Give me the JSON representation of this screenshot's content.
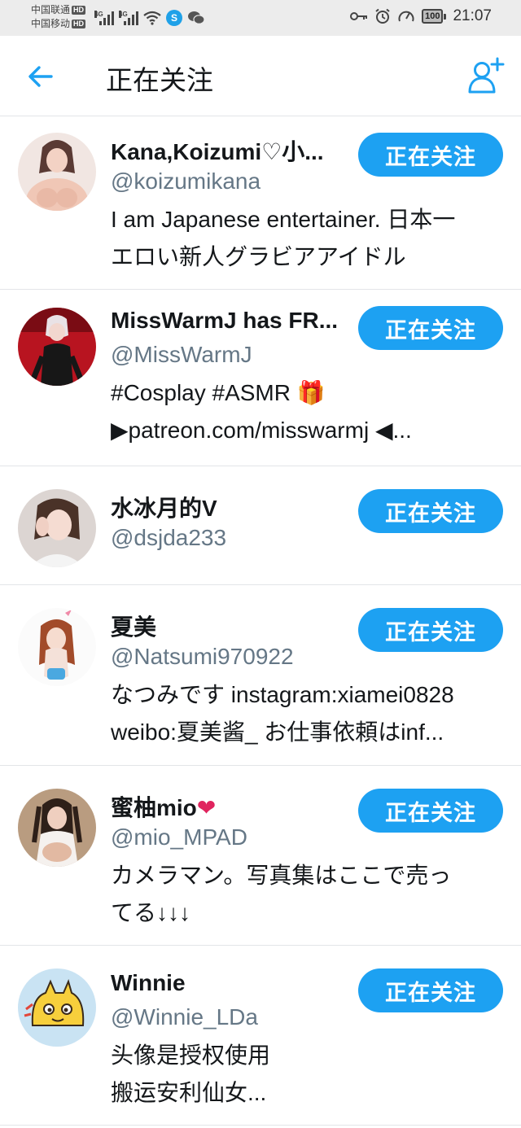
{
  "status_bar": {
    "carrier1": "中国联通",
    "carrier2": "中国移动",
    "hd": "HD",
    "net1": "4G",
    "net2": "4G",
    "battery": "100",
    "time": "21:07"
  },
  "header": {
    "title": "正在关注",
    "back_icon": "arrow-left-icon",
    "add_icon": "add-user-icon"
  },
  "users": [
    {
      "name": "Kana,Koizumi♡小...",
      "handle": "@koizumikana",
      "bio": [
        "I am Japanese entertainer.  日本一",
        "エロい新人グラビアアイドル"
      ],
      "button": "正在关注"
    },
    {
      "name": "MissWarmJ has FR...",
      "handle": "@MissWarmJ",
      "bio": [
        "#Cosplay #ASMR 🎁",
        "▶patreon.com/misswarmj ◀..."
      ],
      "button": "正在关注"
    },
    {
      "name": "水冰月的V",
      "handle": "@dsjda233",
      "bio": [],
      "button": "正在关注"
    },
    {
      "name": "夏美",
      "handle": "@Natsumi970922",
      "bio": [
        "なつみです instagram:xiamei0828",
        "weibo:夏美酱_ お仕事依頼はinf..."
      ],
      "button": "正在关注"
    },
    {
      "name": "蜜柚mio",
      "name_emoji": "❤",
      "handle": "@mio_MPAD",
      "bio": [
        "カメラマン。写真集はここで売っ",
        "てる↓↓↓"
      ],
      "button": "正在关注"
    },
    {
      "name": "Winnie",
      "handle": "@Winnie_LDa",
      "bio": [
        "头像是授权使用",
        "搬运安利仙女..."
      ],
      "button": "正在关注"
    }
  ],
  "colors": {
    "accent": "#1da1f2",
    "text": "#14171a",
    "secondary": "#657786",
    "divider": "#e3e5e8"
  }
}
